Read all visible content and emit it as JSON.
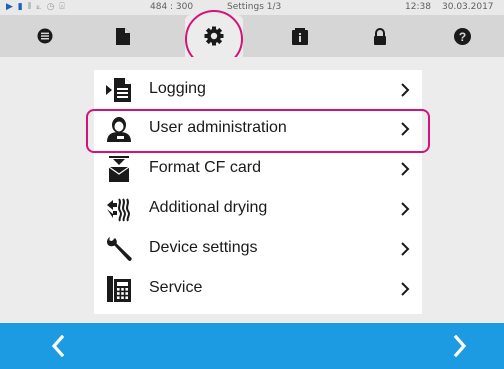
{
  "status_bar": {
    "icons": [
      "play-icon",
      "document-icon",
      "drying-icon",
      "chart-icon",
      "clock-icon",
      "lock-icon"
    ],
    "coords": "484 : 300",
    "title": "Settings 1/3",
    "time": "12:38",
    "date": "30.03.2017"
  },
  "tabs": [
    {
      "icon": "menu-icon",
      "active": false
    },
    {
      "icon": "document-icon",
      "active": false
    },
    {
      "icon": "gear-icon",
      "active": true
    },
    {
      "icon": "info-icon",
      "active": false
    },
    {
      "icon": "lock-icon",
      "active": false
    },
    {
      "icon": "help-icon",
      "active": false
    }
  ],
  "menu": {
    "items": [
      {
        "label": "Logging",
        "icon": "logging-icon"
      },
      {
        "label": "User administration",
        "icon": "user-icon"
      },
      {
        "label": "Format CF card",
        "icon": "format-card-icon"
      },
      {
        "label": "Additional drying",
        "icon": "drying-icon"
      },
      {
        "label": "Device settings",
        "icon": "wrench-icon"
      },
      {
        "label": "Service",
        "icon": "service-phone-icon"
      }
    ]
  },
  "colors": {
    "accent": "#1c9be3",
    "highlight": "#d4137a",
    "icon_dark": "#1a1a1a"
  }
}
